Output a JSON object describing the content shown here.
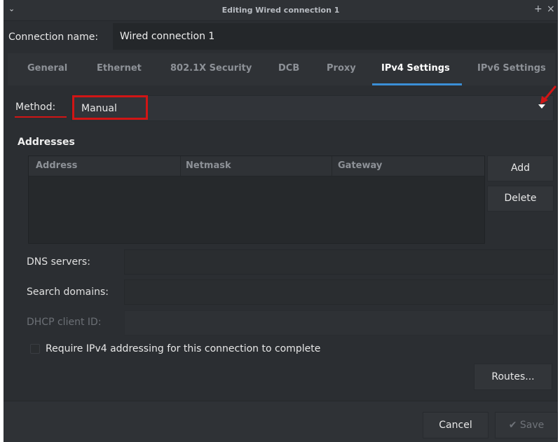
{
  "window": {
    "title": "Editing Wired connection 1",
    "menu_icon": "chevron-down-icon",
    "minimize_glyph": "+",
    "close_glyph": "×"
  },
  "connection": {
    "label": "Connection name:",
    "value": "Wired connection 1"
  },
  "tabs": [
    {
      "label": "General"
    },
    {
      "label": "Ethernet"
    },
    {
      "label": "802.1X Security"
    },
    {
      "label": "DCB"
    },
    {
      "label": "Proxy"
    },
    {
      "label": "IPv4 Settings",
      "active": true
    },
    {
      "label": "IPv6 Settings"
    }
  ],
  "method": {
    "label": "Method:",
    "value": "Manual"
  },
  "addresses": {
    "heading": "Addresses",
    "columns": [
      "Address",
      "Netmask",
      "Gateway"
    ],
    "rows": [],
    "add_label": "Add",
    "delete_label": "Delete"
  },
  "fields": {
    "dns_label": "DNS servers:",
    "dns_value": "",
    "search_label": "Search domains:",
    "search_value": "",
    "dhcp_label": "DHCP client ID:",
    "dhcp_value": ""
  },
  "require_ipv4": {
    "label": "Require IPv4 addressing for this connection to complete",
    "checked": false
  },
  "routes_label": "Routes...",
  "footer": {
    "cancel_label": "Cancel",
    "save_label": "✔ Save"
  },
  "colors": {
    "accent": "#3b8fd6",
    "annotation_red": "#d11515",
    "background": "#2b2e32"
  }
}
